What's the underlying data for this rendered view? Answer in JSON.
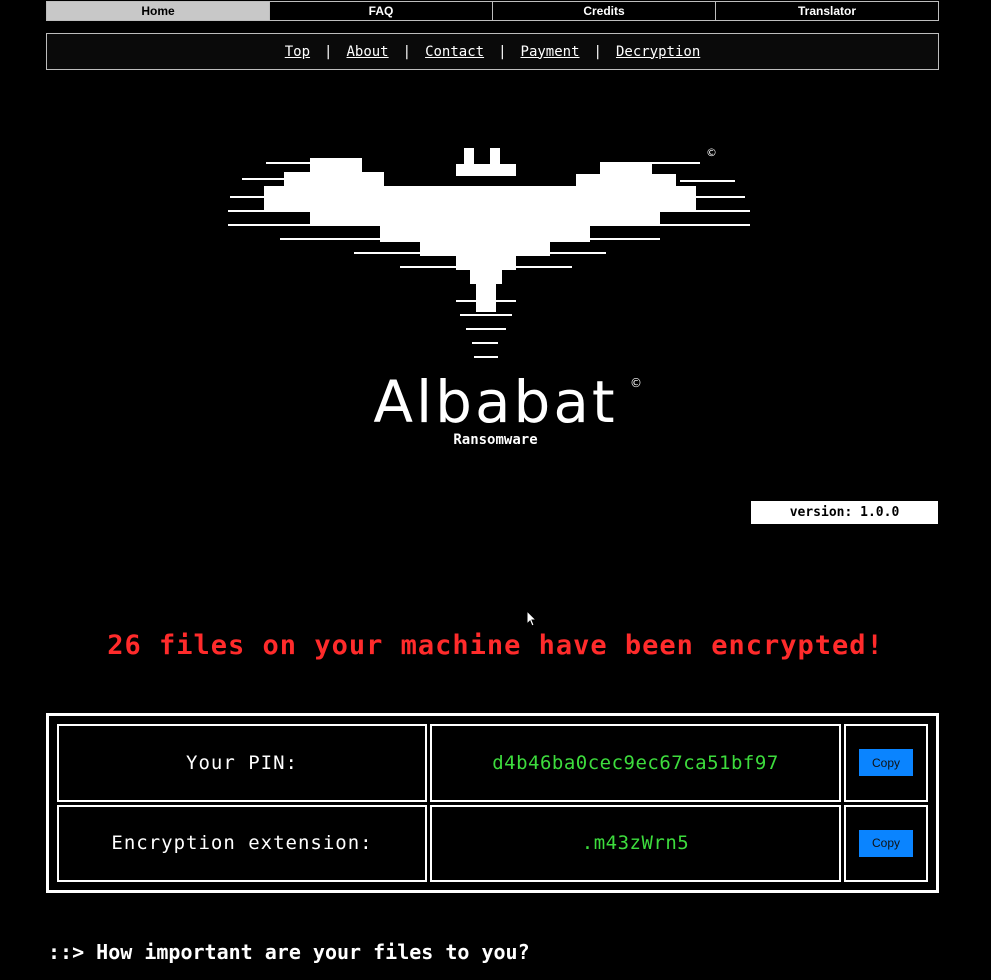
{
  "tabs": [
    {
      "label": "Home",
      "active": true
    },
    {
      "label": "FAQ",
      "active": false
    },
    {
      "label": "Credits",
      "active": false
    },
    {
      "label": "Translator",
      "active": false
    }
  ],
  "subnav": {
    "links": [
      "Top",
      "About",
      "Contact",
      "Payment",
      "Decryption"
    ],
    "separator": "|"
  },
  "logo": {
    "title": "Albabat",
    "copyright": "©",
    "subtitle": "Ransomware"
  },
  "version": "version: 1.0.0",
  "alert": "26 files on your machine have been encrypted!",
  "info": {
    "pin_label": "Your PIN:",
    "pin_value": "d4b46ba0cec9ec67ca51bf97",
    "ext_label": "Encryption extension:",
    "ext_value": ".m43zWrn5",
    "copy_label": "Copy"
  },
  "question": "::> How important are your files to you?",
  "colors": {
    "background": "#000000",
    "alert": "#ff2b2b",
    "value": "#3ddc3d",
    "button": "#0a84ff"
  }
}
